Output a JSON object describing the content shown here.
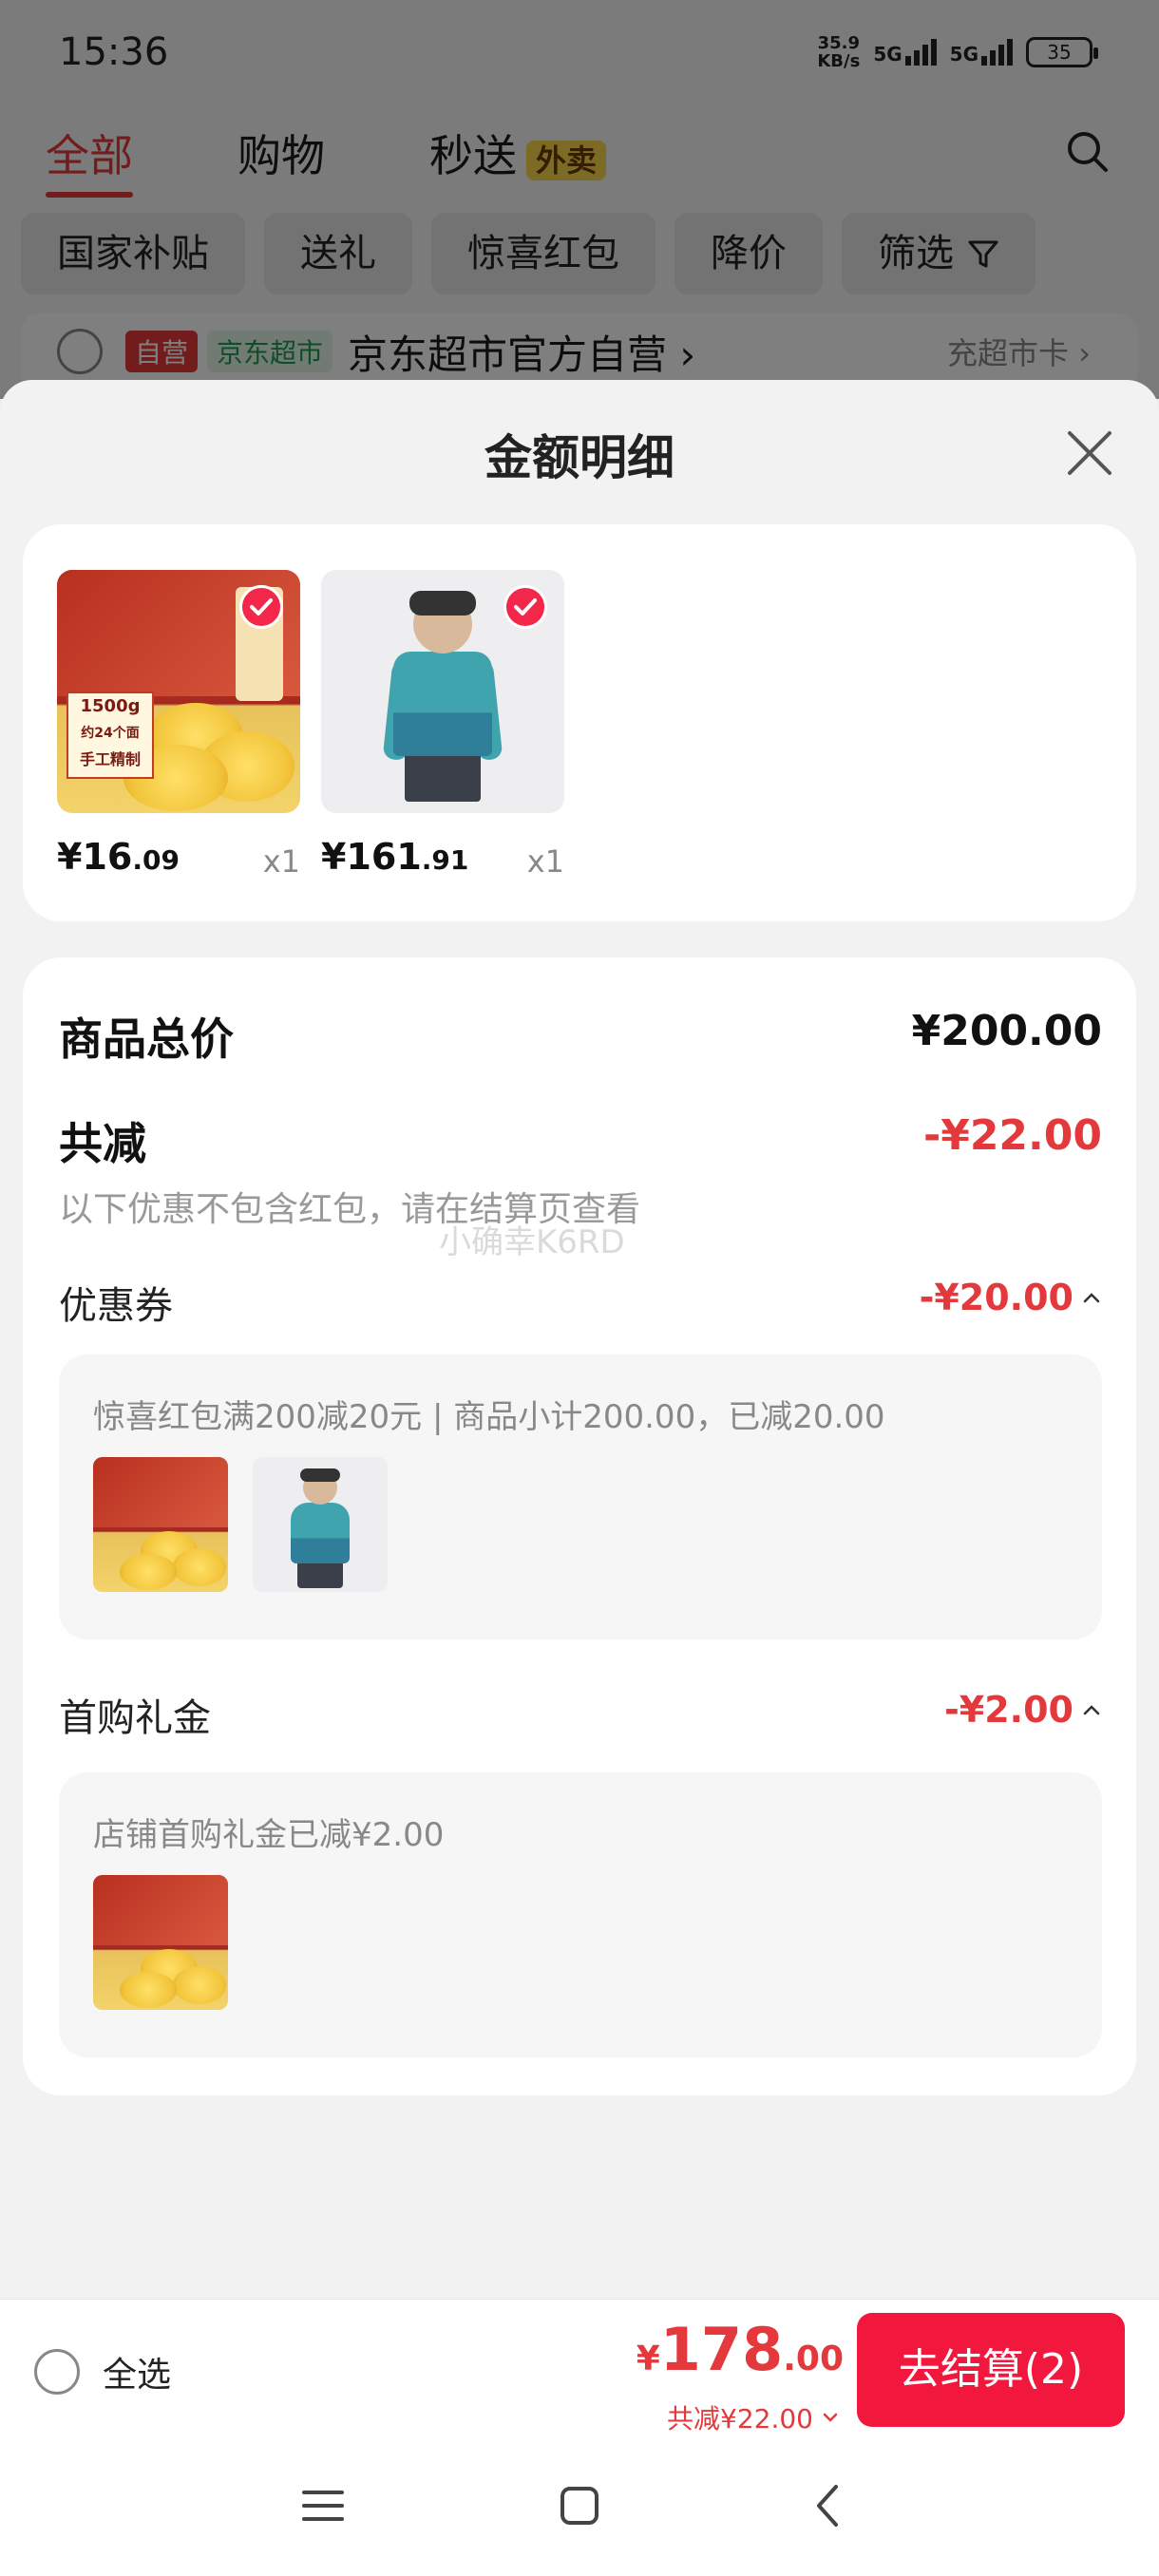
{
  "status_bar": {
    "time": "15:36",
    "net_speed_top": "35.9",
    "net_speed_bottom": "KB/s",
    "signal1": "5G",
    "signal2": "5G",
    "battery": "35"
  },
  "top_tabs": [
    {
      "label": "全部"
    },
    {
      "label": "购物"
    },
    {
      "label": "秒送",
      "badge": "外卖"
    }
  ],
  "filters": [
    "国家补贴",
    "送礼",
    "惊喜红包",
    "降价",
    "筛选"
  ],
  "shop": {
    "tag1": "自营",
    "tag2": "京东超市",
    "name": "京东超市官方自营 ›",
    "link": "充超市卡 ›"
  },
  "sheet": {
    "title": "金额明细",
    "products": [
      {
        "price_int": "¥16",
        "price_dec": ".09",
        "qty": "x1",
        "image": "noodle-box"
      },
      {
        "price_int": "¥161",
        "price_dec": ".91",
        "qty": "x1",
        "image": "kids-ski-jacket"
      }
    ],
    "noodle_label": [
      "1500g",
      "约24个面",
      "手工精制"
    ],
    "total_label": "商品总价",
    "total_value": "¥200.00",
    "discount_label": "共减",
    "discount_value": "-¥22.00",
    "discount_note": "以下优惠不包含红包，请在结算页查看",
    "watermark": "小确幸K6RD",
    "coupon": {
      "label": "优惠券",
      "value": "-¥20.00",
      "detail": "惊喜红包满200减20元 | 商品小计200.00，已减20.00"
    },
    "first_buy": {
      "label": "首购礼金",
      "value": "-¥2.00",
      "detail": "店铺首购礼金已减¥2.00"
    }
  },
  "bottom_bar": {
    "select_all": "全选",
    "yen": "¥",
    "total_int": "178",
    "total_dec": ".00",
    "total_discount": "共减¥22.00",
    "checkout": "去结算(2)"
  },
  "colors": {
    "accent": "#e4393c",
    "checkout_bg": "#f2173d"
  }
}
